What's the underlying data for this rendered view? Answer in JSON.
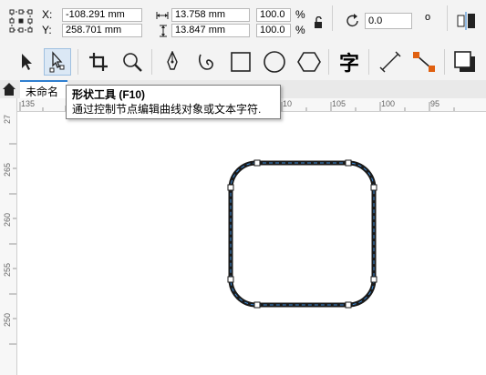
{
  "props": {
    "x_label": "X:",
    "y_label": "Y:",
    "x_value": "-108.291 mm",
    "y_value": "258.701 mm",
    "width_value": "13.758 mm",
    "height_value": "13.847 mm",
    "scale_w": "100.0",
    "scale_h": "100.0",
    "percent": "%",
    "rotation_value": "0.0",
    "degree": "o"
  },
  "toolbar": {
    "pick_tool": "pick-tool-icon",
    "shape_tool": "shape-tool-icon",
    "crop_tool": "crop-tool-icon",
    "zoom_tool": "zoom-tool-icon",
    "pen_tool": "pen-tool-icon",
    "artistic_tool": "artistic-media-icon",
    "rect_tool": "rectangle-tool-icon",
    "ellipse_tool": "ellipse-tool-icon",
    "polygon_tool": "polygon-tool-icon",
    "text_tool_label": "字",
    "dimension_tool": "dimension-tool-icon",
    "connector_tool": "connector-tool-icon",
    "shadow_tool": "drop-shadow-icon"
  },
  "tabs": {
    "home": "home-icon",
    "document_tab": "未命名"
  },
  "tooltip": {
    "title": "形状工具 (F10)",
    "desc": "通过控制节点编辑曲线对象或文本字符."
  },
  "rulers": {
    "h_ticks": [
      "135",
      "10",
      "105",
      "100",
      "95"
    ],
    "v_ticks": [
      "27",
      "265",
      "260",
      "255",
      "250"
    ]
  },
  "colors": {
    "accent": "#2f7fd0",
    "connector_node": "#e06010",
    "shape_outline": "#1a1a1a",
    "path_dash": "#3a8ad8"
  }
}
